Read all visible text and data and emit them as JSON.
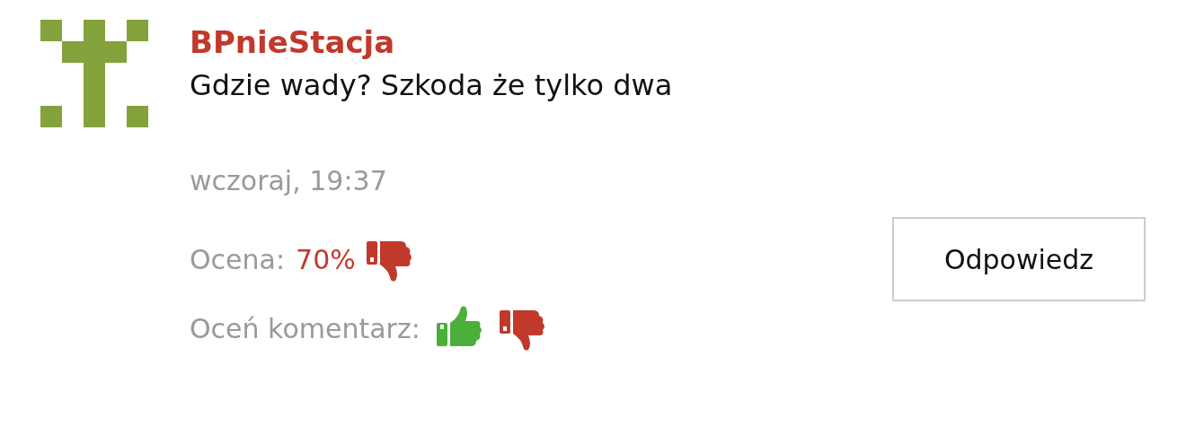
{
  "comment": {
    "author": "BPnieStacja",
    "text": "Gdzie wady? Szkoda że tylko dwa",
    "date": "wczoraj, 19:37",
    "rating_label": "Ocena:",
    "rating_value": "70%",
    "rate_label": "Oceń komentarz:",
    "reply_button": "Odpowiedz"
  }
}
